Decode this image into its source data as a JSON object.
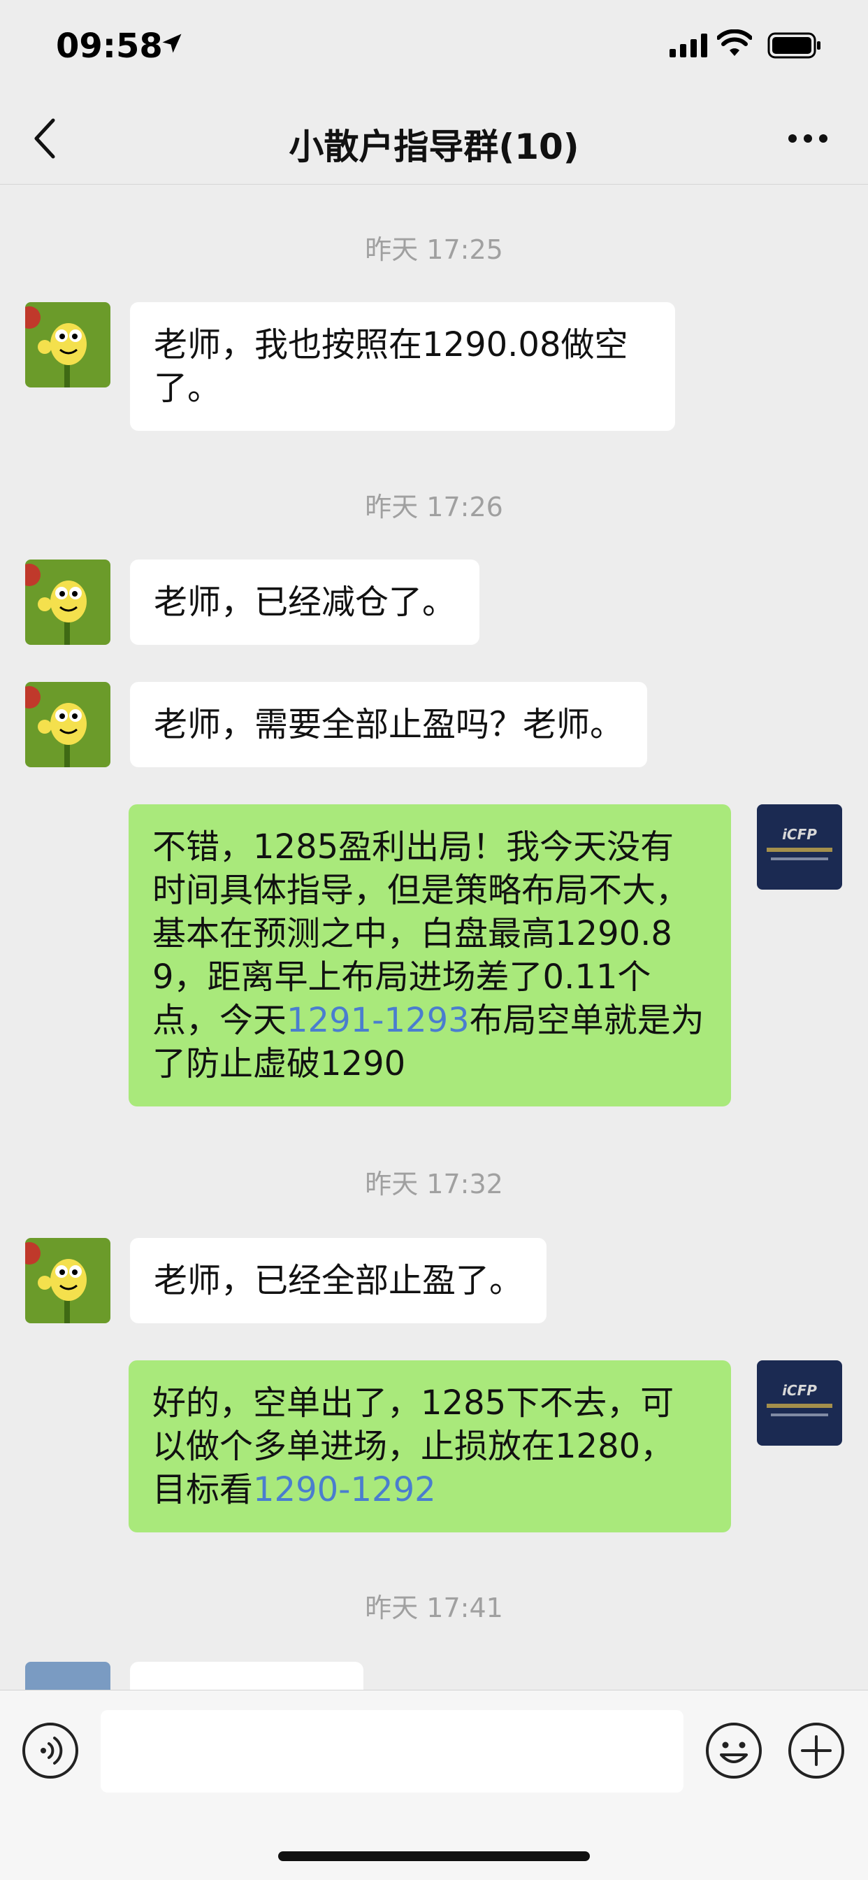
{
  "status": {
    "time": "09:58"
  },
  "nav": {
    "title": "小散户指导群(10)"
  },
  "messages": [
    {
      "type": "timestamp",
      "text": "昨天 17:25"
    },
    {
      "type": "incoming",
      "text": "老师，我也按照在1290.08做空了。"
    },
    {
      "type": "timestamp",
      "text": "昨天 17:26"
    },
    {
      "type": "incoming",
      "text": "老师，已经减仓了。"
    },
    {
      "type": "incoming",
      "text": "老师，需要全部止盈吗？老师。"
    },
    {
      "type": "outgoing",
      "parts": [
        "不错，1285盈利出局！我今天没有时间具体指导，但是策略布局不大，基本在预测之中，白盘最高1290.89，距离早上布局进场差了0.11个点，今天",
        "1291-1293",
        "布局空单就是为了防止虚破1290"
      ]
    },
    {
      "type": "timestamp",
      "text": "昨天 17:32"
    },
    {
      "type": "incoming",
      "text": "老师，已经全部止盈了。"
    },
    {
      "type": "outgoing",
      "parts": [
        "好的，空单出了，1285下不去，可以做个多单进场，止损放在1280，目标看",
        "1290-1292"
      ]
    },
    {
      "type": "timestamp",
      "text": "昨天 17:41"
    }
  ],
  "input": {
    "value": "",
    "placeholder": ""
  },
  "colors": {
    "background": "#ededed",
    "incoming_bubble": "#ffffff",
    "outgoing_bubble": "#a9e97b",
    "link": "#4a7dcf",
    "timestamp": "#a0a0a0"
  },
  "icons": {
    "back": "chevron-left-icon",
    "more": "more-dots-icon",
    "voice": "voice-icon",
    "emoji": "emoji-icon",
    "plus": "plus-icon"
  }
}
